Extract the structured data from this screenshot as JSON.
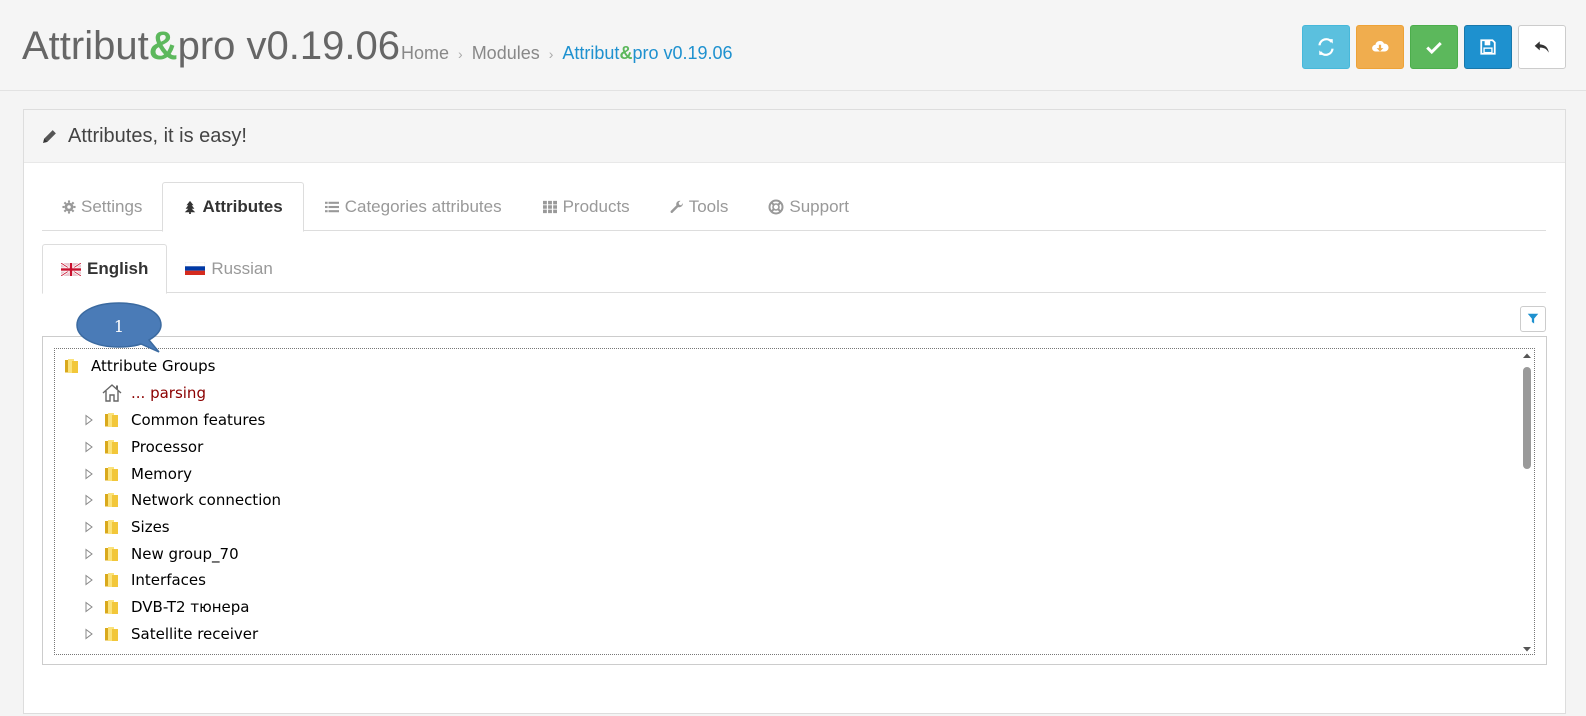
{
  "header": {
    "title_prefix": "Attribut",
    "title_amp": "&",
    "title_suffix": "pro v0.19.06",
    "breadcrumb": [
      {
        "label": "Home"
      },
      {
        "label": "Modules"
      }
    ],
    "breadcrumb_active_prefix": "Attribut",
    "breadcrumb_active_amp": "&",
    "breadcrumb_active_suffix": "pro v0.19.06",
    "separator": "›"
  },
  "toolbar": {
    "buttons": [
      {
        "name": "refresh",
        "icon": "refresh-icon",
        "color": "#5bc0de"
      },
      {
        "name": "download",
        "icon": "cloud-download-icon",
        "color": "#f0ad4e"
      },
      {
        "name": "apply",
        "icon": "check-icon",
        "color": "#5cb85c"
      },
      {
        "name": "save",
        "icon": "save-icon",
        "color": "#1e91cf"
      },
      {
        "name": "back",
        "icon": "reply-icon",
        "color": "#ffffff"
      }
    ]
  },
  "panel": {
    "heading": "Attributes, it is easy!",
    "heading_icon": "pencil-icon"
  },
  "tabs": [
    {
      "label": "Settings",
      "icon": "gear-icon",
      "active": false
    },
    {
      "label": "Attributes",
      "icon": "tree-icon",
      "active": true
    },
    {
      "label": "Categories attributes",
      "icon": "list-icon",
      "active": false
    },
    {
      "label": "Products",
      "icon": "grid-icon",
      "active": false
    },
    {
      "label": "Tools",
      "icon": "wrench-icon",
      "active": false
    },
    {
      "label": "Support",
      "icon": "lifebuoy-icon",
      "active": false
    }
  ],
  "languages": [
    {
      "label": "English",
      "flag": "uk-flag-icon",
      "active": true
    },
    {
      "label": "Russian",
      "flag": "ru-flag-icon",
      "active": false
    }
  ],
  "callout": {
    "number": "1",
    "color": "#4a7bb7"
  },
  "tree": {
    "root": "Attribute Groups",
    "parsing_label": "... parsing",
    "groups": [
      "Common features",
      "Processor",
      "Memory",
      "Network connection",
      "Sizes",
      "New group_70",
      "Interfaces",
      "DVB-T2 тюнера",
      "Satellite receiver"
    ]
  }
}
